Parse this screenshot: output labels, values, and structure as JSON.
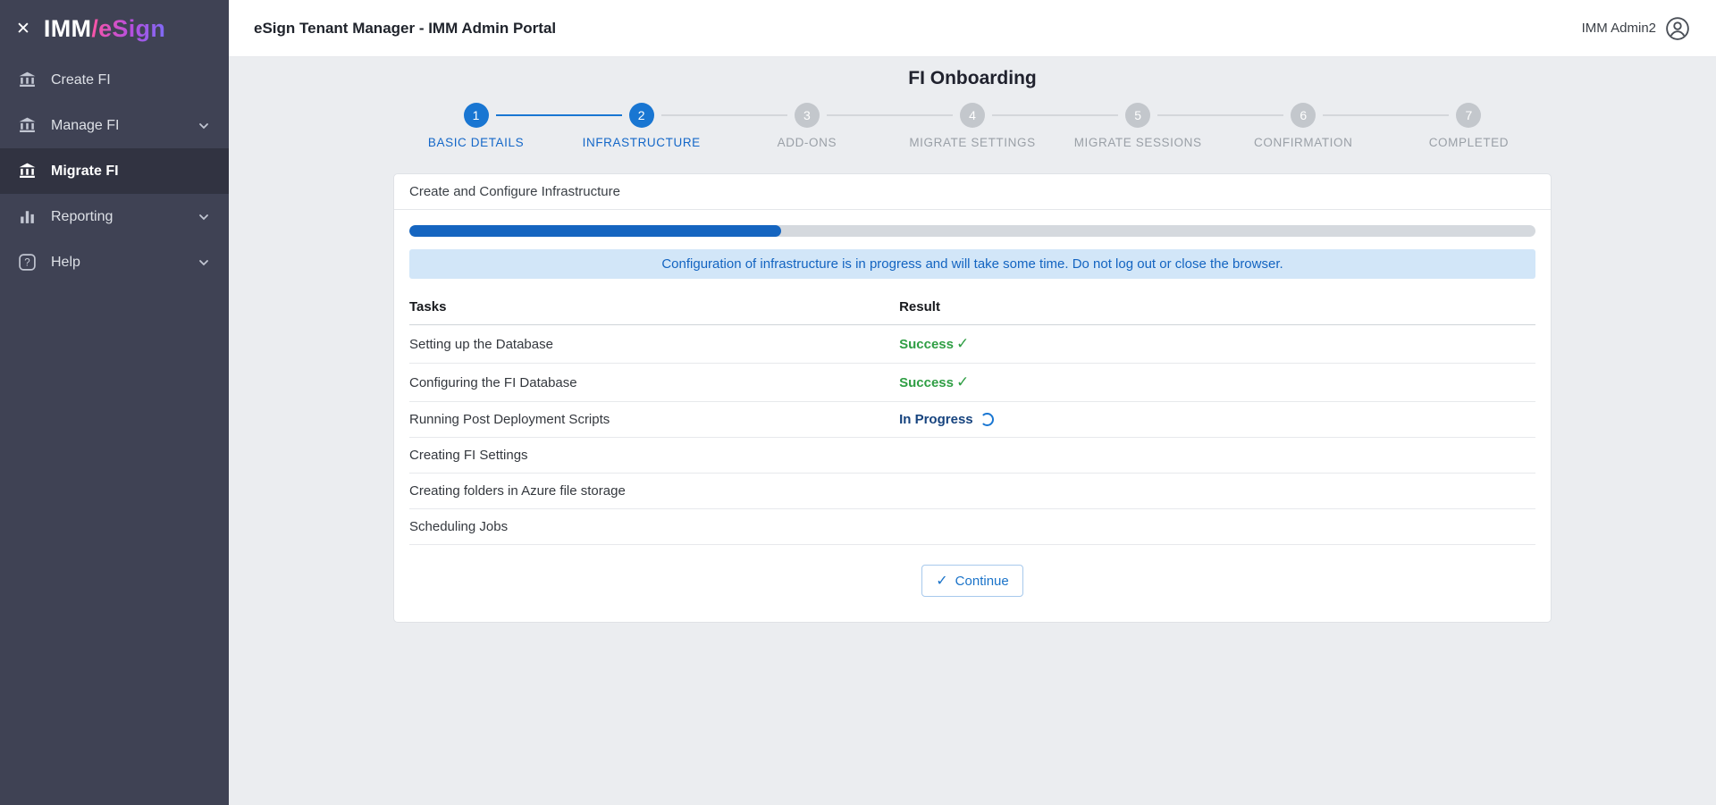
{
  "icons": {
    "close": "✕",
    "check": "✓"
  },
  "sidebar": {
    "logo_imm": "IMM",
    "logo_esign": "/eSign",
    "items": [
      {
        "label": "Create FI",
        "icon": "bank-icon",
        "expandable": false,
        "active": false
      },
      {
        "label": "Manage FI",
        "icon": "bank-icon",
        "expandable": true,
        "active": false
      },
      {
        "label": "Migrate FI",
        "icon": "bank-icon",
        "expandable": false,
        "active": true
      },
      {
        "label": "Reporting",
        "icon": "chart-icon",
        "expandable": true,
        "active": false
      },
      {
        "label": "Help",
        "icon": "help-icon",
        "expandable": true,
        "active": false
      }
    ]
  },
  "header": {
    "title": "eSign Tenant Manager - IMM Admin Portal",
    "user_name": "IMM Admin2"
  },
  "page_title": "FI Onboarding",
  "stepper": {
    "steps": [
      {
        "number": "1",
        "label": "BASIC DETAILS",
        "state": "active"
      },
      {
        "number": "2",
        "label": "INFRASTRUCTURE",
        "state": "active"
      },
      {
        "number": "3",
        "label": "ADD-ONS",
        "state": "inactive"
      },
      {
        "number": "4",
        "label": "MIGRATE SETTINGS",
        "state": "inactive"
      },
      {
        "number": "5",
        "label": "MIGRATE SESSIONS",
        "state": "inactive"
      },
      {
        "number": "6",
        "label": "CONFIRMATION",
        "state": "inactive"
      },
      {
        "number": "7",
        "label": "COMPLETED",
        "state": "inactive"
      }
    ]
  },
  "card": {
    "title": "Create and Configure Infrastructure",
    "progress_percent": 33,
    "banner": "Configuration of infrastructure is in progress and will take some time. Do not log out or close the browser.",
    "table": {
      "headers": [
        "Tasks",
        "Result"
      ],
      "rows": [
        {
          "task": "Setting up the Database",
          "result": "Success",
          "status": "success"
        },
        {
          "task": "Configuring the FI Database",
          "result": "Success",
          "status": "success"
        },
        {
          "task": "Running Post Deployment Scripts",
          "result": "In Progress",
          "status": "in-progress"
        },
        {
          "task": "Creating FI Settings",
          "result": "",
          "status": "pending"
        },
        {
          "task": "Creating folders in Azure file storage",
          "result": "",
          "status": "pending"
        },
        {
          "task": "Scheduling Jobs",
          "result": "",
          "status": "pending"
        }
      ]
    },
    "continue_label": "Continue"
  },
  "colors": {
    "sidebar_bg": "#3f4254",
    "accent_blue": "#1976d2",
    "progress_fill": "#1565c0",
    "banner_bg": "#d2e6f8",
    "banner_text": "#1364c1",
    "success_green": "#2f9e44",
    "in_progress_navy": "#16437e",
    "page_bg": "#ebedf0"
  }
}
